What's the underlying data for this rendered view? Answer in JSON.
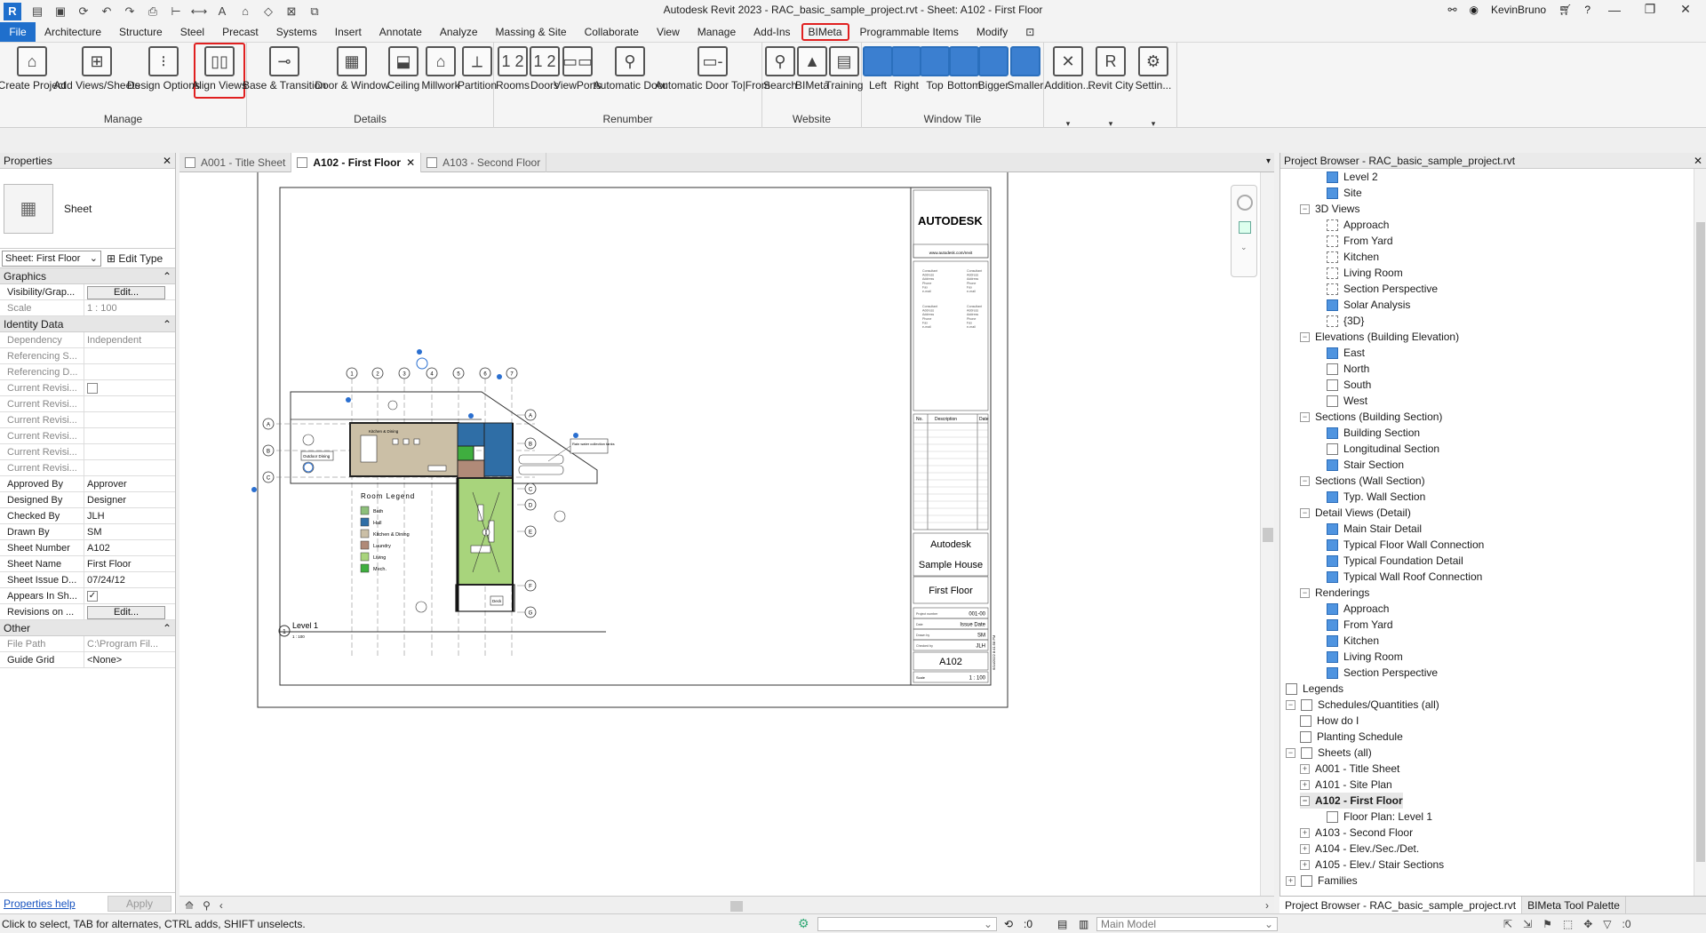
{
  "titlebar": {
    "app_icon": "R",
    "title": "Autodesk Revit 2023 - RAC_basic_sample_project.rvt - Sheet: A102 - First Floor",
    "user": "KevinBruno",
    "quick_access_icons": [
      "open-icon",
      "save-icon",
      "sync-icon",
      "undo-icon",
      "redo-icon",
      "print-icon",
      "measure-icon",
      "dimension-icon",
      "text-icon",
      "3d-view-icon",
      "section-icon",
      "close-views-icon",
      "switch-windows-icon"
    ]
  },
  "menu": {
    "file": "File",
    "items": [
      "Architecture",
      "Structure",
      "Steel",
      "Precast",
      "Systems",
      "Insert",
      "Annotate",
      "Analyze",
      "Massing & Site",
      "Collaborate",
      "View",
      "Manage",
      "Add-Ins",
      "BIMeta",
      "Programmable Items",
      "Modify"
    ],
    "highlighted": "BIMeta"
  },
  "ribbon": {
    "panels": [
      {
        "title": "Manage",
        "buttons": [
          "Create Project",
          "Add Views/Sheets",
          "Design Options",
          "Align Views"
        ]
      },
      {
        "title": "Details",
        "buttons": [
          "Base & Transition",
          "Door & Window",
          "Ceiling",
          "Millwork",
          "Partition"
        ]
      },
      {
        "title": "Renumber",
        "buttons": [
          "Rooms",
          "Doors",
          "ViewPorts",
          "Automatic Door",
          "Automatic Door To|From"
        ]
      },
      {
        "title": "Website",
        "buttons": [
          "Search",
          "BIMeta",
          "Training"
        ]
      },
      {
        "title": "Window Tile",
        "buttons": [
          "Left",
          "Right",
          "Top",
          "Bottom",
          "Bigger",
          "Smaller"
        ]
      },
      {
        "title": "",
        "buttons": [
          "Addition...",
          "Revit City",
          "Settin..."
        ]
      }
    ],
    "highlighted_button": "Align Views"
  },
  "properties": {
    "title": "Properties",
    "type_name": "Sheet",
    "type_selector": "Sheet: First Floor",
    "edit_type": "Edit Type",
    "groups": [
      {
        "name": "Graphics",
        "rows": [
          {
            "k": "Visibility/Grap...",
            "v": "Edit...",
            "kind": "button"
          },
          {
            "k": "Scale",
            "v": "1 : 100",
            "kind": "dim"
          }
        ]
      },
      {
        "name": "Identity Data",
        "rows": [
          {
            "k": "Dependency",
            "v": "Independent",
            "kind": "dim"
          },
          {
            "k": "Referencing S...",
            "v": "",
            "kind": "dim"
          },
          {
            "k": "Referencing D...",
            "v": "",
            "kind": "dim"
          },
          {
            "k": "Current Revisi...",
            "v": "",
            "kind": "dimcheck"
          },
          {
            "k": "Current Revisi...",
            "v": "",
            "kind": "dim"
          },
          {
            "k": "Current Revisi...",
            "v": "",
            "kind": "dim"
          },
          {
            "k": "Current Revisi...",
            "v": "",
            "kind": "dim"
          },
          {
            "k": "Current Revisi...",
            "v": "",
            "kind": "dim"
          },
          {
            "k": "Current Revisi...",
            "v": "",
            "kind": "dim"
          },
          {
            "k": "Approved By",
            "v": "Approver",
            "kind": "text"
          },
          {
            "k": "Designed By",
            "v": "Designer",
            "kind": "text"
          },
          {
            "k": "Checked By",
            "v": "JLH",
            "kind": "text"
          },
          {
            "k": "Drawn By",
            "v": "SM",
            "kind": "text"
          },
          {
            "k": "Sheet Number",
            "v": "A102",
            "kind": "text"
          },
          {
            "k": "Sheet Name",
            "v": "First Floor",
            "kind": "text"
          },
          {
            "k": "Sheet Issue D...",
            "v": "07/24/12",
            "kind": "text"
          },
          {
            "k": "Appears In Sh...",
            "v": "✓",
            "kind": "check"
          },
          {
            "k": "Revisions on ...",
            "v": "Edit...",
            "kind": "button"
          }
        ]
      },
      {
        "name": "Other",
        "rows": [
          {
            "k": "File Path",
            "v": "C:\\Program Fil...",
            "kind": "dim"
          },
          {
            "k": "Guide Grid",
            "v": "<None>",
            "kind": "text"
          }
        ]
      }
    ],
    "help": "Properties help",
    "apply": "Apply"
  },
  "doc_tabs": [
    {
      "label": "A001 - Title Sheet",
      "active": false
    },
    {
      "label": "A102 - First Floor",
      "active": true
    },
    {
      "label": "A103 - Second Floor",
      "active": false
    }
  ],
  "sheet": {
    "logo": "AUTODESK",
    "website": "www.autodesk.com/revit",
    "consultant_lines": [
      "Consultant",
      "Address",
      "Address",
      "Phone",
      "Fax",
      "e-mail"
    ],
    "rev_headers": [
      "No.",
      "Description",
      "Date"
    ],
    "client": "Autodesk",
    "project": "Sample House",
    "sheet_title": "First Floor",
    "info": [
      {
        "k": "Project number",
        "v": "001-00"
      },
      {
        "k": "Date",
        "v": "Issue Date"
      },
      {
        "k": "Drawn by",
        "v": "SM"
      },
      {
        "k": "Checked by",
        "v": "JLH"
      }
    ],
    "sheet_number": "A102",
    "scale_label": "Scale",
    "scale_value": "1 : 100",
    "side_stamp": "6/14/2022 8:41:58 PM",
    "view_title": "Level 1",
    "view_number": "1",
    "view_scale": "1 : 100",
    "legend_title": "Room Legend",
    "legend_items": [
      {
        "label": "Bath",
        "color": "#8dbf7a"
      },
      {
        "label": "Hall",
        "color": "#2f6ea6"
      },
      {
        "label": "Kitchen & Dining",
        "color": "#cbbfa6"
      },
      {
        "label": "Laundry",
        "color": "#b08a78"
      },
      {
        "label": "Living",
        "color": "#a8d47c"
      },
      {
        "label": "Mech.",
        "color": "#3fae3f"
      }
    ],
    "grid_numbers": [
      "1",
      "2",
      "3",
      "4",
      "5",
      "6",
      "7"
    ],
    "grid_letters_left": [
      "A",
      "B",
      "C"
    ],
    "grid_letters_right": [
      "A",
      "B",
      "C",
      "D",
      "E",
      "F",
      "G"
    ],
    "plan_labels": [
      "Kitchen & Dining",
      "Outdoor Dining",
      "Rain water collection tanks",
      "Deck"
    ]
  },
  "project_browser": {
    "title": "Project Browser - RAC_basic_sample_project.rvt",
    "nodes": [
      {
        "label": "Level 2",
        "depth": 2,
        "icon": "blue"
      },
      {
        "label": "Site",
        "depth": 2,
        "icon": "blue"
      },
      {
        "label": "3D Views",
        "depth": 1,
        "icon": "group"
      },
      {
        "label": "Approach",
        "depth": 2,
        "icon": "dash"
      },
      {
        "label": "From Yard",
        "depth": 2,
        "icon": "dash"
      },
      {
        "label": "Kitchen",
        "depth": 2,
        "icon": "dash"
      },
      {
        "label": "Living Room",
        "depth": 2,
        "icon": "dash"
      },
      {
        "label": "Section Perspective",
        "depth": 2,
        "icon": "dash"
      },
      {
        "label": "Solar Analysis",
        "depth": 2,
        "icon": "blue"
      },
      {
        "label": "{3D}",
        "depth": 2,
        "icon": "dash"
      },
      {
        "label": "Elevations (Building Elevation)",
        "depth": 1,
        "icon": "group"
      },
      {
        "label": "East",
        "depth": 2,
        "icon": "blue"
      },
      {
        "label": "North",
        "depth": 2,
        "icon": "plain"
      },
      {
        "label": "South",
        "depth": 2,
        "icon": "plain"
      },
      {
        "label": "West",
        "depth": 2,
        "icon": "plain"
      },
      {
        "label": "Sections (Building Section)",
        "depth": 1,
        "icon": "group"
      },
      {
        "label": "Building Section",
        "depth": 2,
        "icon": "blue"
      },
      {
        "label": "Longitudinal Section",
        "depth": 2,
        "icon": "plain"
      },
      {
        "label": "Stair Section",
        "depth": 2,
        "icon": "blue"
      },
      {
        "label": "Sections (Wall Section)",
        "depth": 1,
        "icon": "group"
      },
      {
        "label": "Typ. Wall Section",
        "depth": 2,
        "icon": "blue"
      },
      {
        "label": "Detail Views (Detail)",
        "depth": 1,
        "icon": "group"
      },
      {
        "label": "Main Stair Detail",
        "depth": 2,
        "icon": "blue"
      },
      {
        "label": "Typical Floor Wall Connection",
        "depth": 2,
        "icon": "blue"
      },
      {
        "label": "Typical Foundation Detail",
        "depth": 2,
        "icon": "blue"
      },
      {
        "label": "Typical Wall Roof Connection",
        "depth": 2,
        "icon": "blue"
      },
      {
        "label": "Renderings",
        "depth": 1,
        "icon": "group"
      },
      {
        "label": "Approach",
        "depth": 2,
        "icon": "blue"
      },
      {
        "label": "From Yard",
        "depth": 2,
        "icon": "blue"
      },
      {
        "label": "Kitchen",
        "depth": 2,
        "icon": "blue"
      },
      {
        "label": "Living Room",
        "depth": 2,
        "icon": "blue"
      },
      {
        "label": "Section Perspective",
        "depth": 2,
        "icon": "blue"
      },
      {
        "label": "Legends",
        "depth": 0,
        "icon": "plain",
        "nox": true
      },
      {
        "label": "Schedules/Quantities (all)",
        "depth": 0,
        "icon": "plain",
        "exp": "−"
      },
      {
        "label": "How do I",
        "depth": 1,
        "icon": "plain",
        "nox": true
      },
      {
        "label": "Planting Schedule",
        "depth": 1,
        "icon": "plain",
        "nox": true
      },
      {
        "label": "Sheets (all)",
        "depth": 0,
        "icon": "plain",
        "exp": "−"
      },
      {
        "label": "A001 - Title Sheet",
        "depth": 1,
        "exp": "+"
      },
      {
        "label": "A101 - Site Plan",
        "depth": 1,
        "exp": "+"
      },
      {
        "label": "A102 - First Floor",
        "depth": 1,
        "exp": "−",
        "bold": true
      },
      {
        "label": "Floor Plan: Level 1",
        "depth": 2,
        "icon": "plain"
      },
      {
        "label": "A103 - Second Floor",
        "depth": 1,
        "exp": "+"
      },
      {
        "label": "A104 - Elev./Sec./Det.",
        "depth": 1,
        "exp": "+"
      },
      {
        "label": "A105 - Elev./ Stair Sections",
        "depth": 1,
        "exp": "+"
      },
      {
        "label": "Families",
        "depth": 0,
        "icon": "plain",
        "exp": "+"
      }
    ],
    "tabs": [
      "Project Browser - RAC_basic_sample_project.rvt",
      "BIMeta Tool Palette"
    ]
  },
  "status": {
    "text": "Click to select, TAB for alternates, CTRL adds, SHIFT unselects.",
    "worksets": ":0",
    "model": "Main Model",
    "filter": ":0"
  }
}
